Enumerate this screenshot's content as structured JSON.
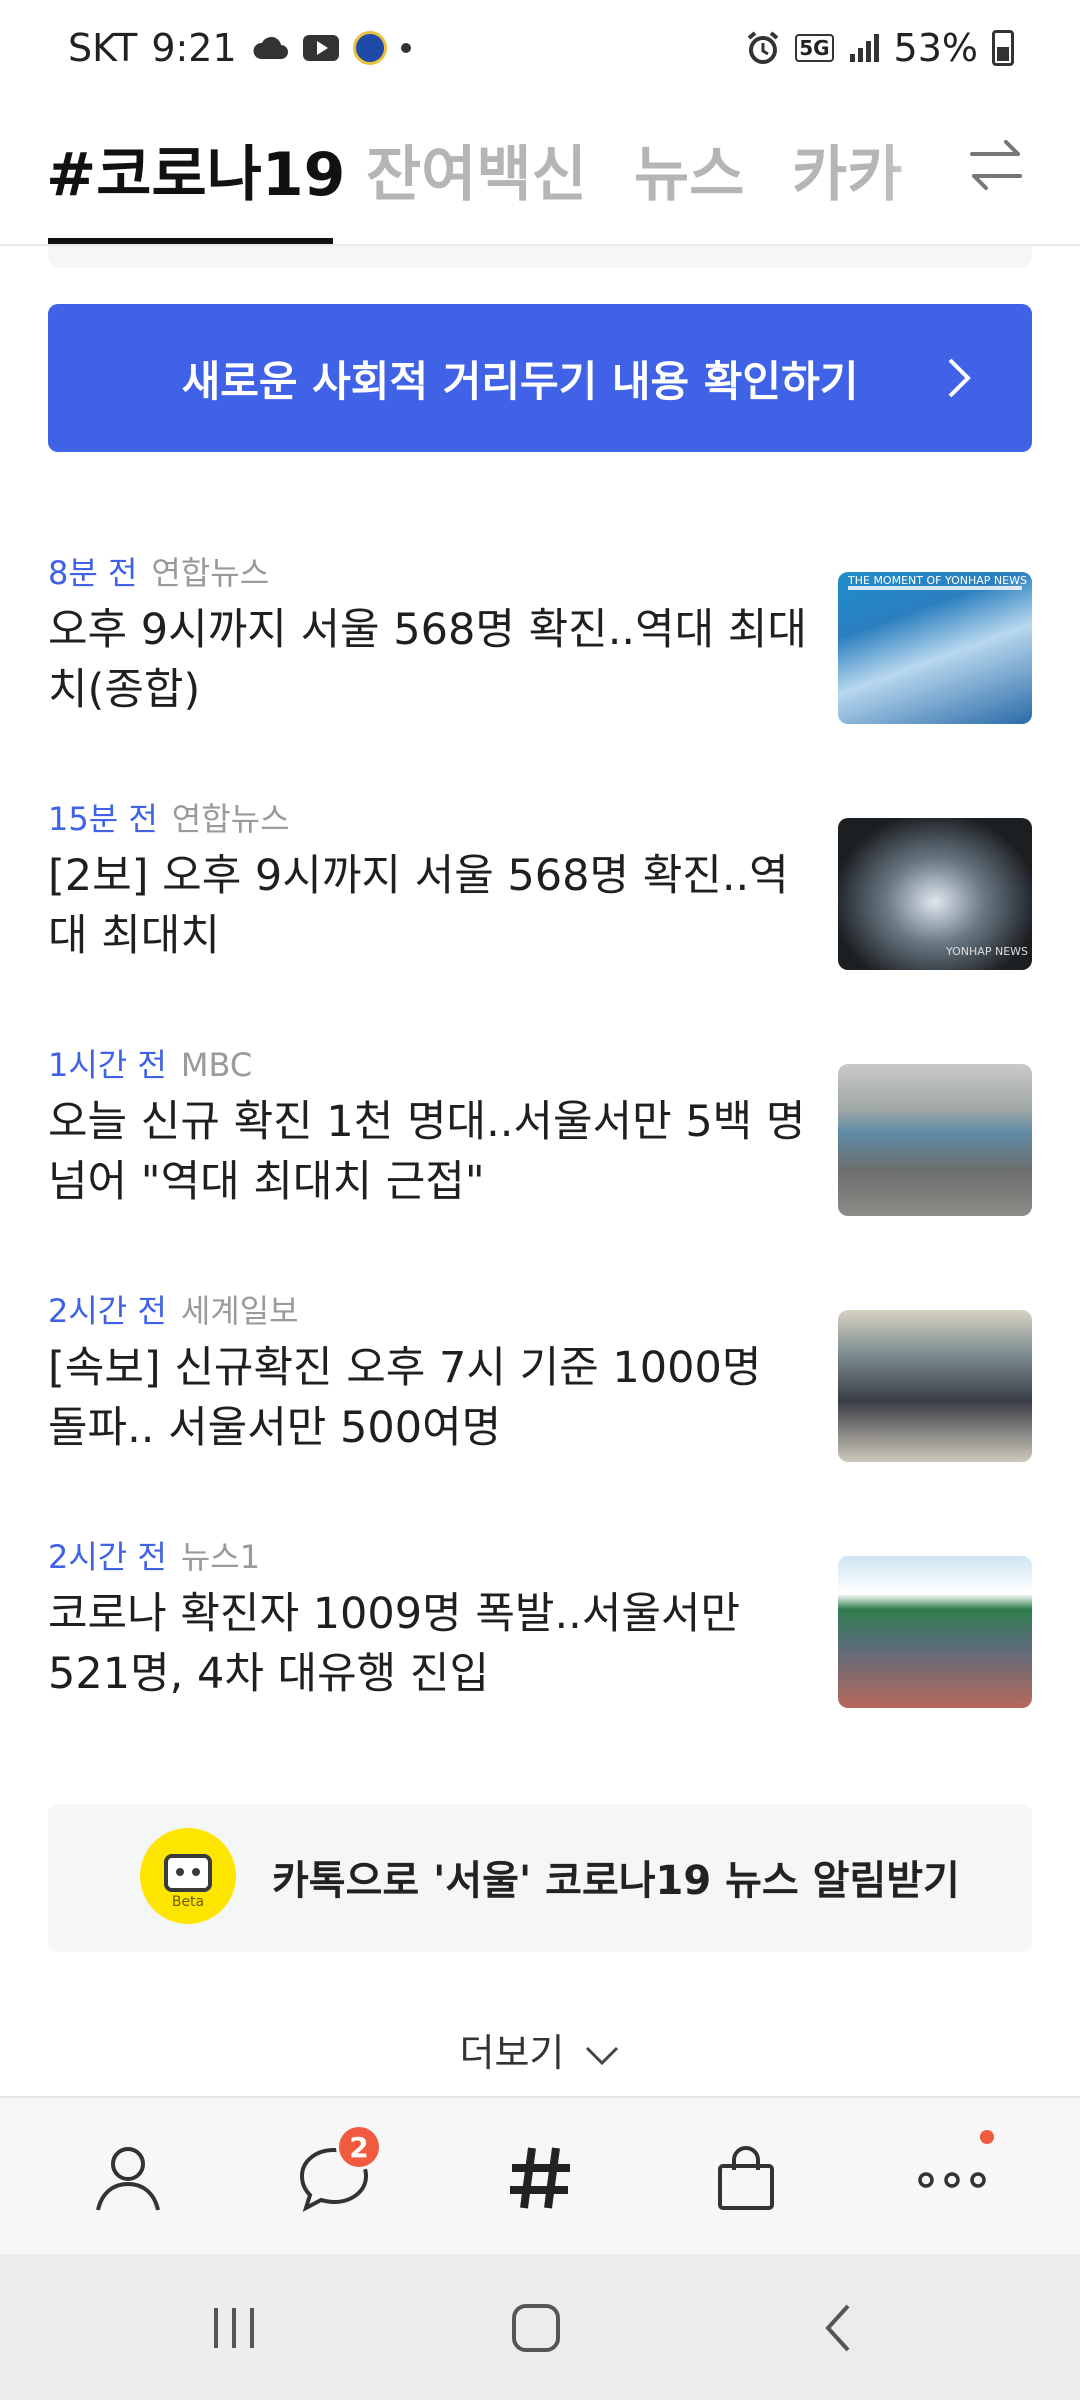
{
  "status_bar": {
    "carrier": "SKT",
    "time": "9:21",
    "network": "5G",
    "battery": "53%"
  },
  "tabs": [
    {
      "label": "#코로나19",
      "active": true
    },
    {
      "label": "잔여백신",
      "active": false
    },
    {
      "label": "뉴스",
      "active": false
    },
    {
      "label": "카카",
      "active": false
    }
  ],
  "banner": {
    "label": "새로운 사회적 거리두기 내용 확인하기"
  },
  "news": [
    {
      "time": "8분 전",
      "source": "연합뉴스",
      "headline": "오후 9시까지 서울 568명 확진..역대 최대치(종합)",
      "thumb_text": "THE MOMENT OF YONHAP NEWS"
    },
    {
      "time": "15분 전",
      "source": "연합뉴스",
      "headline": "[2보] 오후 9시까지 서울 568명 확진..역대 최대치",
      "thumb_text": "YONHAP NEWS"
    },
    {
      "time": "1시간 전",
      "source": "MBC",
      "headline": "오늘 신규 확진 1천 명대..서울서만 5백 명 넘어 \"역대 최대치 근접\"",
      "thumb_text": ""
    },
    {
      "time": "2시간 전",
      "source": "세계일보",
      "headline": "[속보] 신규확진 오후 7시 기준 1000명 돌파.. 서울서만 500여명",
      "thumb_text": ""
    },
    {
      "time": "2시간 전",
      "source": "뉴스1",
      "headline": "코로나 확진자 1009명 폭발..서울서만 521명, 4차 대유행 진입",
      "thumb_text": ""
    }
  ],
  "kakao_alert": {
    "label": "카톡으로 '서울' 코로나19 뉴스 알림받기",
    "bot_tag": "Beta"
  },
  "more": {
    "label": "더보기"
  },
  "bottom_nav": {
    "chat_badge": "2"
  },
  "colors": {
    "accent": "#3f62e7",
    "badge": "#f05a3e",
    "kakao_yellow": "#fee500"
  }
}
